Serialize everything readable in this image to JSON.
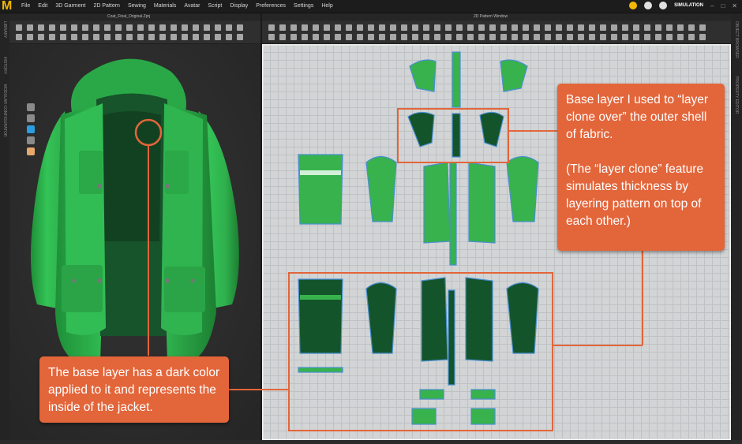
{
  "menubar": {
    "logo": "M",
    "items": [
      "File",
      "Edit",
      "3D Garment",
      "2D Pattern",
      "Sewing",
      "Materials",
      "Avatar",
      "Script",
      "Display",
      "Preferences",
      "Settings",
      "Help"
    ],
    "mode_label": "SIMULATION"
  },
  "windows": {
    "file_title": "Coat_Final_Original.Zprj",
    "pattern_title": "2D Pattern Window"
  },
  "side_tabs": {
    "left": [
      "LIBRARY",
      "HISTORY",
      "MODULAR CONFIGURATOR"
    ],
    "right": [
      "OBJECT BROWSER",
      "PROPERTY EDITOR"
    ]
  },
  "callouts": {
    "right": {
      "line1": "Base layer I used to “layer clone over” the outer shell of fabric.",
      "line2": "(The “layer clone” feature simulates thickness by layering pattern on top of each other.)"
    },
    "left": {
      "text": "The base layer has a dark color applied to it and represents the inside of the jacket."
    }
  },
  "colors": {
    "accent": "#e3653a",
    "fabric_light": "#37b24d",
    "fabric_dark": "#14542b",
    "outline": "#4a8fd0"
  }
}
